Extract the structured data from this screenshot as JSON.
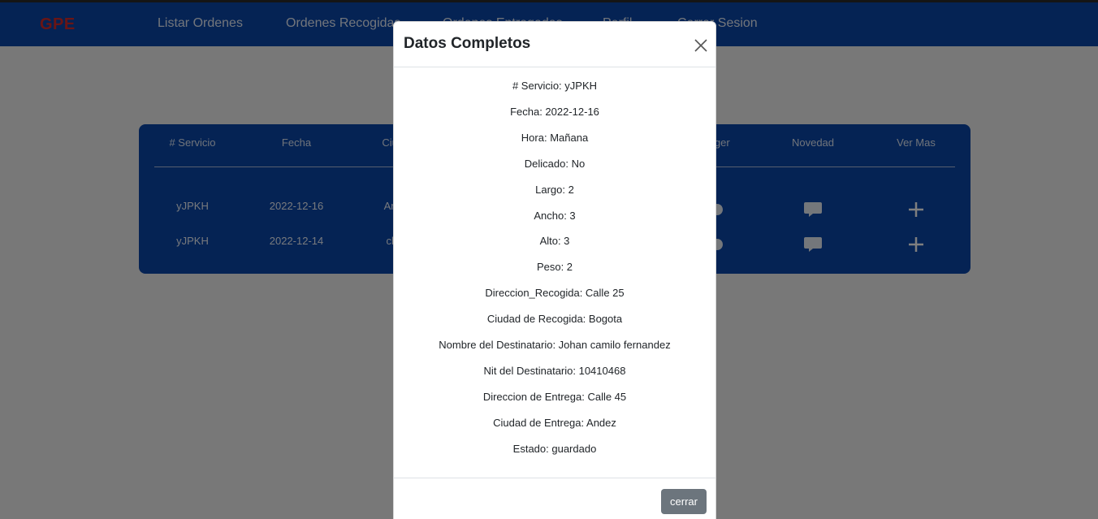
{
  "navbar": {
    "brand": "GPE",
    "links": [
      "Listar Ordenes",
      "Ordenes Recogidas",
      "Ordenes Entregadas",
      "Perfil",
      "Cerrar Sesion"
    ]
  },
  "table": {
    "headers": [
      "# Servicio",
      "Fecha",
      "Ciudad",
      "",
      "",
      "",
      "Manager",
      "Novedad",
      "Ver Mas"
    ],
    "rows": [
      {
        "servicio": "yJPKH",
        "fecha": "2022-12-16",
        "ciudad": "Andez"
      },
      {
        "servicio": "yJPKH",
        "fecha": "2022-12-14",
        "ciudad": "china"
      }
    ],
    "icons": {
      "manager": "user-gear-icon",
      "novedad": "comment-icon",
      "ver_mas": "plus-icon"
    }
  },
  "modal": {
    "title": "Datos Completos",
    "close_icon": "close-icon",
    "details": [
      "# Servicio: yJPKH",
      "Fecha: 2022-12-16",
      "Hora: Mañana",
      "Delicado: No",
      "Largo: 2",
      "Ancho: 3",
      "Alto: 3",
      "Peso: 2",
      "Direccion_Recogida: Calle 25",
      "Ciudad de Recogida: Bogota",
      "Nombre del Destinatario: Johan camilo fernandez",
      "Nit del Destinatario: 10410468",
      "Direccion de Entrega: Calle 45",
      "Ciudad de Entrega: Andez",
      "Estado: guardado"
    ],
    "close_button": "cerrar"
  },
  "colors": {
    "navbar": "#0a47a9",
    "brand": "#d42b2b",
    "card": "#0a47a9",
    "button": "#6c757d"
  }
}
